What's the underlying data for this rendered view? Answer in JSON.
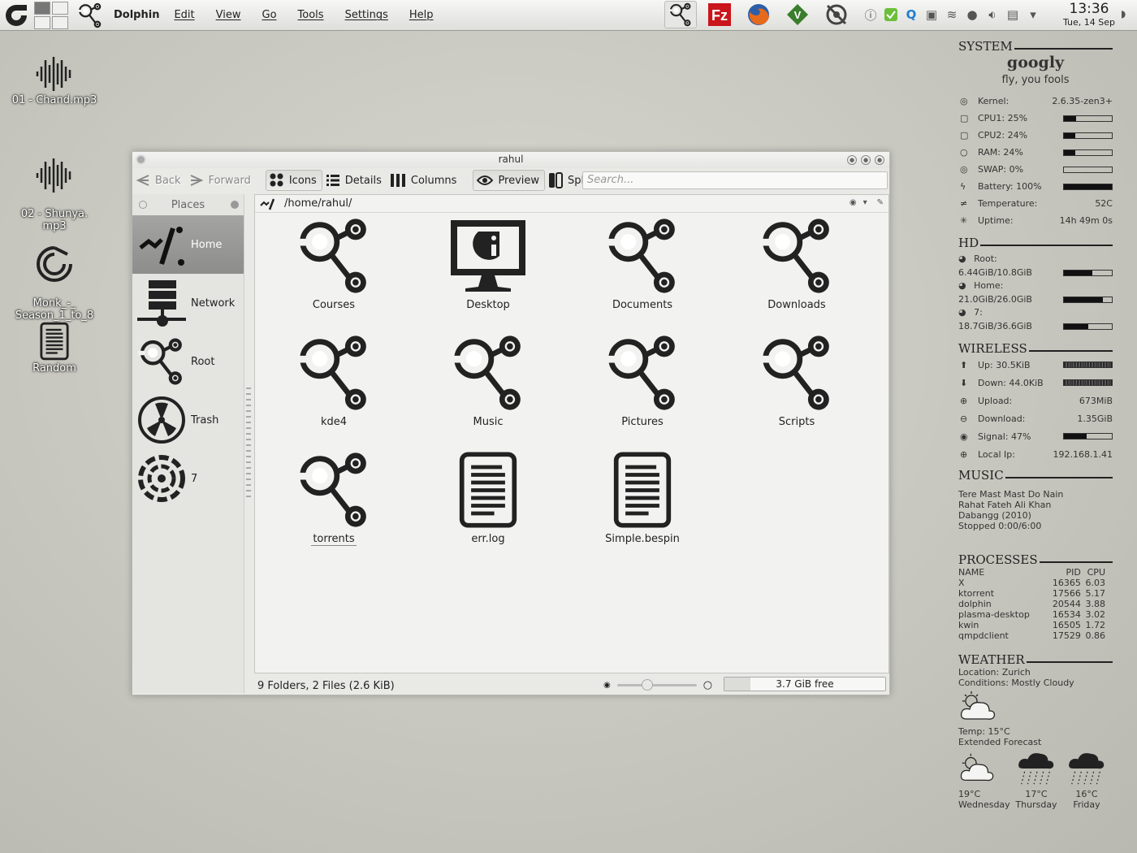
{
  "panel": {
    "app_name": "Dolphin",
    "menu": [
      "Edit",
      "View",
      "Go",
      "Tools",
      "Settings",
      "Help"
    ],
    "clock": {
      "time": "13:36",
      "date": "Tue, 14 Sep"
    },
    "launchers": [
      "dolphin-icon",
      "filezilla-icon",
      "firefox-icon",
      "vim-icon",
      "settings-icon"
    ]
  },
  "desktop_icons": [
    {
      "label": "01 - Chand.mp3",
      "icon": "audio-icon"
    },
    {
      "label": "02 - Shunya.\nmp3",
      "icon": "audio-icon"
    },
    {
      "label": "Monk_-_\nSeason_1_to_8",
      "icon": "torrent-icon"
    },
    {
      "label": "Random",
      "icon": "document-icon"
    }
  ],
  "window": {
    "title": "rahul",
    "toolbar": {
      "back": "Back",
      "forward": "Forward",
      "icons": "Icons",
      "details": "Details",
      "columns": "Columns",
      "preview": "Preview",
      "split": "Split",
      "search_placeholder": "Search..."
    },
    "places": {
      "header": "Places",
      "items": [
        {
          "label": "Home",
          "icon": "home-icon",
          "active": true
        },
        {
          "label": "Network",
          "icon": "network-icon"
        },
        {
          "label": "Root",
          "icon": "folder-icon"
        },
        {
          "label": "Trash",
          "icon": "trash-icon"
        },
        {
          "label": "7",
          "icon": "disk-icon"
        }
      ]
    },
    "location": "/home/rahul/",
    "files": [
      {
        "name": "Courses",
        "type": "folder"
      },
      {
        "name": "Desktop",
        "type": "desktop"
      },
      {
        "name": "Documents",
        "type": "folder"
      },
      {
        "name": "Downloads",
        "type": "folder"
      },
      {
        "name": "kde4",
        "type": "folder"
      },
      {
        "name": "Music",
        "type": "folder"
      },
      {
        "name": "Pictures",
        "type": "folder"
      },
      {
        "name": "Scripts",
        "type": "folder"
      },
      {
        "name": "torrents",
        "type": "folder"
      },
      {
        "name": "err.log",
        "type": "file"
      },
      {
        "name": "Simple.bespin",
        "type": "file"
      }
    ],
    "status": "9 Folders, 2 Files (2.6 KiB)",
    "zoom_level": 0.38,
    "free_space": {
      "text": "3.7 GiB free",
      "used_fraction": 0.16
    }
  },
  "conky": {
    "system": {
      "title": "SYSTEM",
      "host": "googly",
      "tagline": "fly, you fools",
      "rows": [
        {
          "label": "Kernel:",
          "value": "2.6.35-zen3+"
        },
        {
          "label": "CPU1: 25%",
          "bar": 0.25
        },
        {
          "label": "CPU2: 24%",
          "bar": 0.24
        },
        {
          "label": "RAM: 24%",
          "bar": 0.24
        },
        {
          "label": "SWAP: 0%",
          "bar": 0.0
        },
        {
          "label": "Battery: 100%",
          "bar": 1.0
        },
        {
          "label": "Temperature:",
          "value": "52C"
        },
        {
          "label": "Uptime:",
          "value": "14h 49m 0s"
        }
      ]
    },
    "hd": {
      "title": "HD",
      "disks": [
        {
          "label": "Root:",
          "usage": "6.44GiB/10.8GiB",
          "bar": 0.6
        },
        {
          "label": "Home:",
          "usage": "21.0GiB/26.0GiB",
          "bar": 0.81
        },
        {
          "label": "7:",
          "usage": "18.7GiB/36.6GiB",
          "bar": 0.51
        }
      ]
    },
    "wireless": {
      "title": "WIRELESS",
      "up": "Up: 30.5KiB",
      "down": "Down: 44.0KiB",
      "upload_label": "Upload:",
      "upload_value": "673MiB",
      "download_label": "Download:",
      "download_value": "1.35GiB",
      "signal": "Signal: 47%",
      "signal_bar": 0.47,
      "ip_label": "Local Ip:",
      "ip_value": "192.168.1.41"
    },
    "music": {
      "title": "MUSIC",
      "song": "Tere Mast Mast Do Nain",
      "artist": "Rahat Fateh Ali Khan",
      "album": "Dabangg (2010)",
      "status": "Stopped 0:00/6:00"
    },
    "processes": {
      "title": "PROCESSES",
      "headers": [
        "NAME",
        "PID",
        "CPU"
      ],
      "rows": [
        [
          "X",
          "16365",
          "6.03"
        ],
        [
          "ktorrent",
          "17566",
          "5.17"
        ],
        [
          "dolphin",
          "20544",
          "3.88"
        ],
        [
          "plasma-desktop",
          "16534",
          "3.02"
        ],
        [
          "kwin",
          "16505",
          "1.72"
        ],
        [
          "qmpdclient",
          "17529",
          "0.86"
        ]
      ]
    },
    "weather": {
      "title": "WEATHER",
      "location": "Location: Zurich",
      "conditions": "Conditions: Mostly Cloudy",
      "temp": "Temp: 15°C",
      "extended": "Extended Forecast",
      "forecast": [
        {
          "temp": "19°C",
          "day": "Wednesday",
          "icon": "partly-cloudy-icon"
        },
        {
          "temp": "17°C",
          "day": "Thursday",
          "icon": "rain-icon"
        },
        {
          "temp": "16°C",
          "day": "Friday",
          "icon": "rain-icon"
        }
      ]
    }
  }
}
